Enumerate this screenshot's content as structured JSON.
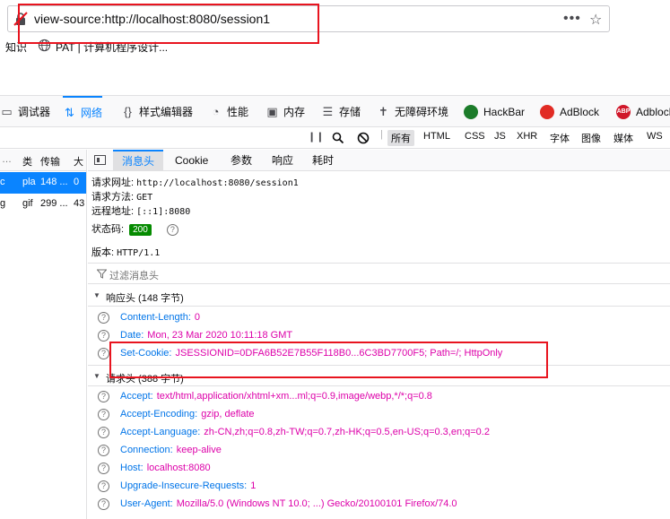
{
  "url_bar": {
    "url": "view-source:http://localhost:8080/session1",
    "more_glyph": "•••",
    "star_glyph": "☆"
  },
  "bookmarks": [
    {
      "label": "知识"
    },
    {
      "label": "PAT | 计算机程序设计..."
    }
  ],
  "devtools_tabs": [
    {
      "label": "调试器",
      "icon": "debugger-icon"
    },
    {
      "label": "网络",
      "icon": "network-icon",
      "active": true
    },
    {
      "label": "样式编辑器",
      "icon": "style-editor-icon"
    },
    {
      "label": "性能",
      "icon": "performance-icon"
    },
    {
      "label": "内存",
      "icon": "memory-icon"
    },
    {
      "label": "存储",
      "icon": "storage-icon"
    },
    {
      "label": "无障碍环境",
      "icon": "accessibility-icon"
    },
    {
      "label": "HackBar",
      "icon": "hackbar-icon",
      "color": "#1c7c2a"
    },
    {
      "label": "AdBlock",
      "icon": "adblock-icon",
      "color": "#e12b24"
    },
    {
      "label": "Adblock",
      "icon": "adblock-plus-icon",
      "color": "#d0172a",
      "badge": "ABP"
    }
  ],
  "filter_types": [
    "所有",
    "HTML",
    "CSS",
    "JS",
    "XHR",
    "字体",
    "图像",
    "媒体",
    "WS"
  ],
  "request_list": {
    "columns": [
      "类",
      "传输",
      "大"
    ],
    "rows": [
      {
        "name": "c",
        "type": "pla",
        "transfer": "148 ...",
        "size": "0 ",
        "selected": true
      },
      {
        "name": "g",
        "type": "gif",
        "transfer": "299 ...",
        "size": "43",
        "selected": false
      }
    ]
  },
  "detail_tabs": [
    "消息头",
    "Cookie",
    "参数",
    "响应",
    "耗时"
  ],
  "summary": {
    "url_label": "请求网址:",
    "url_value": "http://localhost:8080/session1",
    "method_label": "请求方法:",
    "method_value": "GET",
    "remote_label": "远程地址:",
    "remote_value": "[::1]:8080",
    "status_label": "状态码:",
    "status_value": "200",
    "version_label": "版本:",
    "version_value": "HTTP/1.1"
  },
  "header_filter_placeholder": "过滤消息头",
  "response_headers": {
    "title": "响应头 (148 字节)",
    "items": [
      {
        "name": "Content-Length:",
        "value": "0"
      },
      {
        "name": "Date:",
        "value": "Mon, 23 Mar 2020 10:11:18 GMT"
      },
      {
        "name": "Set-Cookie:",
        "value": "JSESSIONID=0DFA6B52E7B55F118B0...6C3BD7700F5; Path=/; HttpOnly"
      }
    ]
  },
  "request_headers": {
    "title": "请求头 (388 字节)",
    "items": [
      {
        "name": "Accept:",
        "value": "text/html,application/xhtml+xm...ml;q=0.9,image/webp,*/*;q=0.8"
      },
      {
        "name": "Accept-Encoding:",
        "value": "gzip, deflate"
      },
      {
        "name": "Accept-Language:",
        "value": "zh-CN,zh;q=0.8,zh-TW;q=0.7,zh-HK;q=0.5,en-US;q=0.3,en;q=0.2"
      },
      {
        "name": "Connection:",
        "value": "keep-alive"
      },
      {
        "name": "Host:",
        "value": "localhost:8080"
      },
      {
        "name": "Upgrade-Insecure-Requests:",
        "value": "1"
      },
      {
        "name": "User-Agent:",
        "value": "Mozilla/5.0 (Windows NT 10.0; ...) Gecko/20100101 Firefox/74.0"
      }
    ]
  },
  "colors": {
    "accent": "#0a84ff",
    "header_name": "#0074e8",
    "header_value": "#dd00a9",
    "status_ok": "#058b00",
    "annotation": "#e8141f"
  }
}
